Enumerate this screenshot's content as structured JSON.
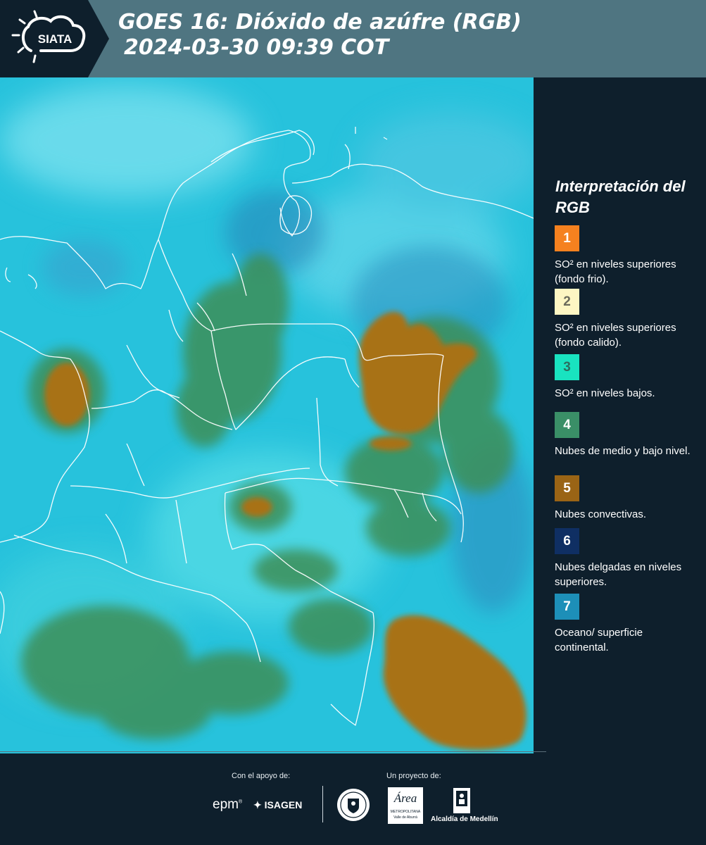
{
  "header": {
    "logo_text": "SIATA",
    "title_line1": "GOES 16: Dióxido de azúfre (RGB)",
    "title_line2": "2024-03-30 09:39 COT"
  },
  "legend": {
    "title": "Interpretación del RGB",
    "items": [
      {
        "number": "1",
        "label": "SO² en niveles superiores (fondo frio).",
        "color": "#f5811f",
        "text_color": "#ffffff"
      },
      {
        "number": "2",
        "label": "SO² en niveles superiores (fondo calido).",
        "color": "#fdf6c3",
        "text_color": "#6b6b5c"
      },
      {
        "number": "3",
        "label": "SO² en niveles bajos.",
        "color": "#19e3c0",
        "text_color": "#2c6e5f"
      },
      {
        "number": "4",
        "label": "Nubes de medio y bajo nivel.",
        "color": "#3a8f67",
        "text_color": "#ffffff"
      },
      {
        "number": "5",
        "label": "Nubes convectivas.",
        "color": "#9a6415",
        "text_color": "#ffffff"
      },
      {
        "number": "6",
        "label": "Nubes delgadas en niveles superiores.",
        "color": "#0f2f63",
        "text_color": "#ffffff"
      },
      {
        "number": "7",
        "label": "Oceano/ superficie continental.",
        "color": "#1d8fb8",
        "text_color": "#ffffff"
      }
    ]
  },
  "footer": {
    "support_label": "Con el apoyo de:",
    "project_label": "Un proyecto de:",
    "sponsor_1": "epm",
    "sponsor_2": "ISAGEN",
    "partner_area": "Área",
    "partner_area_sub": "METROPOLITANA",
    "partner_area_sub2": "Valle de Aburrá",
    "partner_alcaldia": "Alcaldía de Medellín"
  },
  "colors": {
    "header_bg": "#4f7581",
    "panel_bg": "#0e1f2c",
    "map_ocean": "#27c2dc",
    "map_cloud_green": "#3c8f58",
    "map_convective": "#a87218"
  }
}
